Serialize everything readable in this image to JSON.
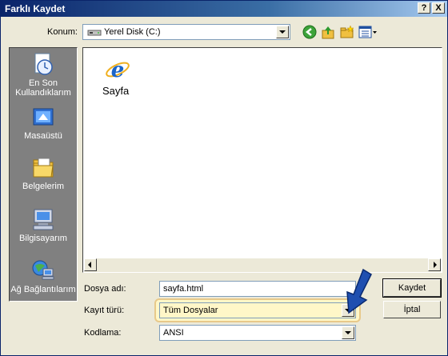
{
  "window": {
    "title": "Farklı Kaydet",
    "help_label": "?",
    "close_label": "X"
  },
  "location": {
    "label": "Konum:",
    "value": "Yerel Disk (C:)"
  },
  "places": [
    {
      "icon": "recent-documents-icon",
      "label_line1": "En Son",
      "label_line2": "Kullandıklarım"
    },
    {
      "icon": "desktop-icon",
      "label_line1": "Masaüstü",
      "label_line2": ""
    },
    {
      "icon": "my-documents-icon",
      "label_line1": "Belgelerim",
      "label_line2": ""
    },
    {
      "icon": "my-computer-icon",
      "label_line1": "Bilgisayarım",
      "label_line2": ""
    },
    {
      "icon": "network-places-icon",
      "label_line1": "Ağ Bağlantılarım",
      "label_line2": ""
    }
  ],
  "files": [
    {
      "icon": "internet-explorer-icon",
      "name": "Sayfa"
    }
  ],
  "form": {
    "filename_label": "Dosya adı:",
    "filename_value": "sayfa.html",
    "filetype_label": "Kayıt türü:",
    "filetype_value": "Tüm Dosyalar",
    "encoding_label": "Kodlama:",
    "encoding_value": "ANSI"
  },
  "buttons": {
    "save": "Kaydet",
    "cancel": "İptal"
  },
  "colors": {
    "titlebar": "#0A246A",
    "dialog_bg": "#ECE9D8",
    "places_bg": "#808080",
    "highlight": "#FFF7C8",
    "arrow": "#1F4FB0"
  }
}
